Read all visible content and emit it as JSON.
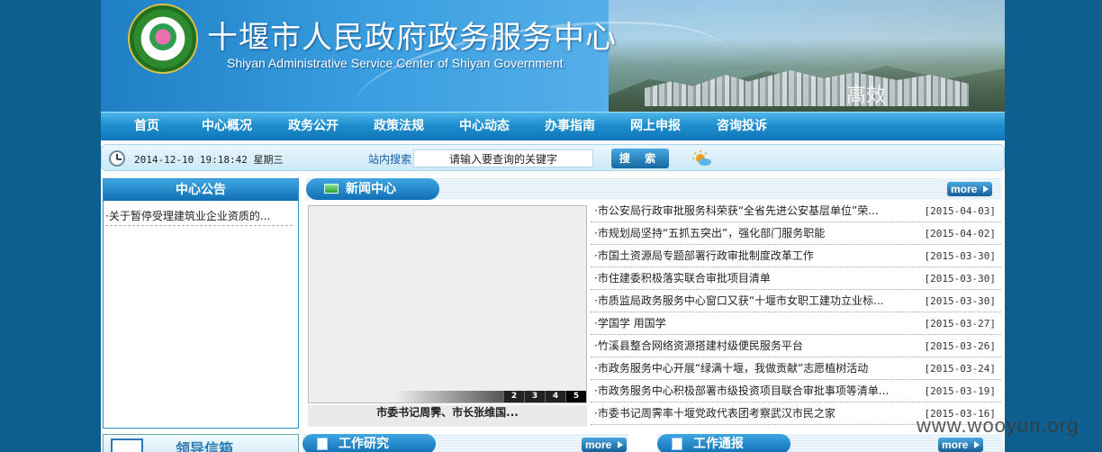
{
  "banner": {
    "title_cn": "十堰市人民政府政务服务中心",
    "title_en": "Shiyan Administrative Service Center of Shiyan Government",
    "slogan": "高效"
  },
  "nav": {
    "items": [
      {
        "label": "首页"
      },
      {
        "label": "中心概况"
      },
      {
        "label": "政务公开"
      },
      {
        "label": "政策法规"
      },
      {
        "label": "中心动态"
      },
      {
        "label": "办事指南"
      },
      {
        "label": "网上申报"
      },
      {
        "label": "咨询投诉"
      }
    ]
  },
  "toolbar": {
    "datetime": "2014-12-10 19:18:42 星期三",
    "search_label": "站内搜索",
    "search_placeholder": "请输入要查询的关键字",
    "search_button": "搜 索"
  },
  "notice": {
    "title": "中心公告",
    "items": [
      "·关于暂停受理建筑业企业资质的..."
    ]
  },
  "news": {
    "title": "新闻中心",
    "more": "more",
    "slide_numbers": [
      "2",
      "3",
      "4",
      "5"
    ],
    "slide_caption": "市委书记周霁、市长张维国...",
    "items": [
      {
        "title": "·市公安局行政审批服务科荣获“全省先进公安基层单位”荣...",
        "date": "[2015-04-03]"
      },
      {
        "title": "·市规划局坚持“五抓五突出”，强化部门服务职能",
        "date": "[2015-04-02]"
      },
      {
        "title": "·市国土资源局专题部署行政审批制度改革工作",
        "date": "[2015-03-30]"
      },
      {
        "title": "·市住建委积极落实联合审批项目清单",
        "date": "[2015-03-30]"
      },
      {
        "title": "·市质监局政务服务中心窗口又获“十堰市女职工建功立业标...",
        "date": "[2015-03-30]"
      },
      {
        "title": "·学国学 用国学",
        "date": "[2015-03-27]"
      },
      {
        "title": "·竹溪县整合网络资源搭建村级便民服务平台",
        "date": "[2015-03-26]"
      },
      {
        "title": "·市政务服务中心开展“绿满十堰，我做贡献”志愿植树活动",
        "date": "[2015-03-24]"
      },
      {
        "title": "·市政务服务中心积极部署市级投资项目联合审批事项等清单...",
        "date": "[2015-03-19]"
      },
      {
        "title": "·市委书记周霁率十堰党政代表团考察武汉市民之家",
        "date": "[2015-03-16]"
      }
    ]
  },
  "bottom": {
    "mail_label": "领导信箱",
    "work_research": "工作研究",
    "work_bulletin": "工作通报",
    "more": "more"
  },
  "watermark": "www.wooyun.org"
}
